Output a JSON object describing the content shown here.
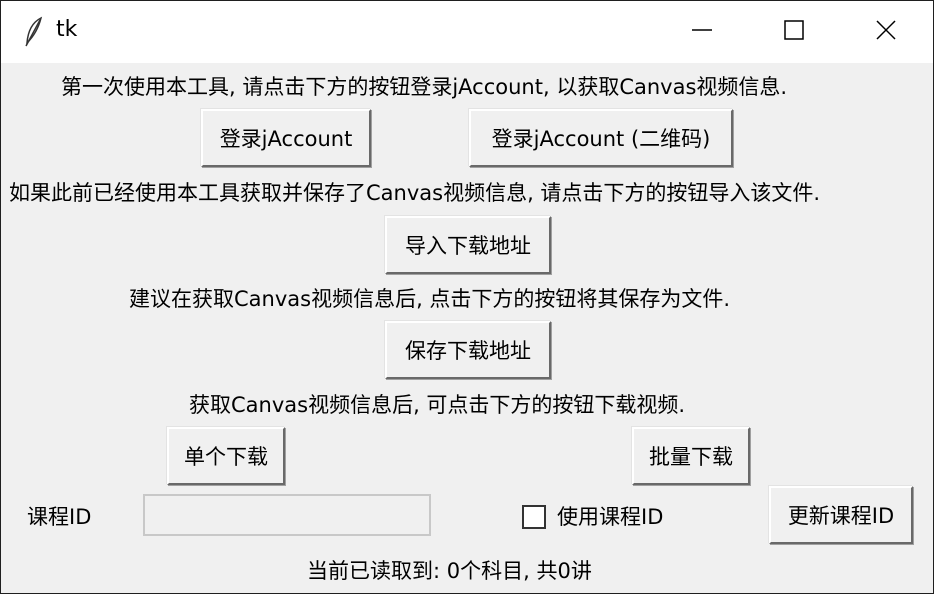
{
  "window": {
    "title": "tk"
  },
  "labels": {
    "first_use": "第一次使用本工具, 请点击下方的按钮登录jAccount, 以获取Canvas视频信息.",
    "import_hint": "如果此前已经使用本工具获取并保存了Canvas视频信息, 请点击下方的按钮导入该文件.",
    "save_hint": "建议在获取Canvas视频信息后, 点击下方的按钮将其保存为文件.",
    "download_hint": "获取Canvas视频信息后, 可点击下方的按钮下载视频.",
    "course_id": "课程ID",
    "status": "当前已读取到: 0个科目, 共0讲"
  },
  "buttons": {
    "login": "登录jAccount",
    "login_qr": "登录jAccount (二维码)",
    "import": "导入下载地址",
    "save": "保存下载地址",
    "single_download": "单个下载",
    "batch_download": "批量下载",
    "update_course_id": "更新课程ID"
  },
  "course_id_input": {
    "value": ""
  },
  "use_course_id_checkbox": {
    "label": "使用课程ID",
    "checked": false
  }
}
